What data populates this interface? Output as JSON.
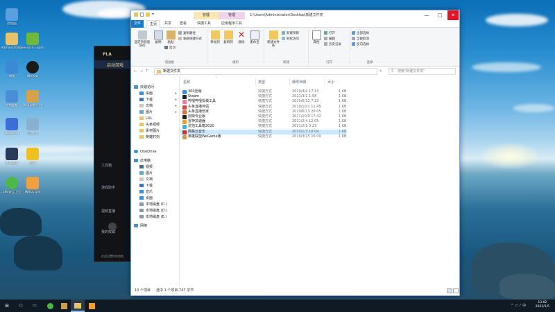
{
  "desktop": {
    "icons": [
      {
        "label": "此电脑",
        "color": "#5aa0e0"
      },
      {
        "label": "Administrator",
        "color": "#e8c36a"
      },
      {
        "label": "GeForce Experience",
        "color": "#6eb83a"
      },
      {
        "label": "网络",
        "color": "#3b8ad8"
      },
      {
        "label": "腾讯QQ",
        "color": "#1a1a1a"
      },
      {
        "label": "控制面板",
        "color": "#4a8fd6"
      },
      {
        "label": "腾讯游戏平台",
        "color": "#d4a24a"
      },
      {
        "label": "WeGame",
        "color": "#3c6fd6"
      },
      {
        "label": "回收站",
        "color": "#8ab0d0"
      },
      {
        "label": "英雄联盟",
        "color": "#2a3a5a"
      },
      {
        "label": "迅雷",
        "color": "#f0c020"
      },
      {
        "label": "360安全卫士",
        "color": "#4cb848"
      },
      {
        "label": "网易云音乐",
        "color": "#f0a040"
      }
    ]
  },
  "client": {
    "title": "PLA",
    "tag": "启动游戏",
    "side_items": [
      "工具箱",
      "游戏助手",
      "视频直播",
      "我的收藏"
    ],
    "banner": "在此设置你的游戏"
  },
  "window": {
    "ctx_tab_1": "管理",
    "ctx_tab_2": "管理",
    "path_title": "C:\\Users\\Administrator\\Desktop\\新建文件夹",
    "minimize": "—",
    "maximize": "□",
    "close": "✕",
    "ribbon_tabs": {
      "file": "文件",
      "home": "主页",
      "share": "共享",
      "view": "查看",
      "shortcut_tools": "快捷工具",
      "app_tools": "应用程序工具"
    },
    "ribbon": {
      "pin_quick": "固定到快速访问",
      "copy": "复制",
      "paste": "粘贴",
      "copy_path": "复制路径",
      "paste_shortcut": "粘贴快捷方式",
      "cut": "剪切",
      "clipboard": "剪贴板",
      "move_to": "移动到",
      "copy_to": "复制到",
      "delete": "删除",
      "rename": "重命名",
      "organize": "组织",
      "new_folder": "新建文件夹",
      "new_item": "新建项目",
      "easy_access": "轻松访问",
      "new": "新建",
      "properties": "属性",
      "open": "打开",
      "edit": "编辑",
      "history": "历史记录",
      "open_group": "打开",
      "select_all": "全部选择",
      "select_none": "全部取消",
      "invert_selection": "反向选择",
      "select": "选择"
    },
    "address": "新建文件夹",
    "search_placeholder": "搜索\"新建文件夹\"",
    "nav": {
      "quick_access": "快速访问",
      "desktop": "桌面",
      "downloads": "下载",
      "documents": "文档",
      "pictures": "图片",
      "lol": "LOL",
      "toutiao_video": "头条视频",
      "material_pics": "素材图片",
      "hero_record": "英雄时刻",
      "onedrive": "OneDrive",
      "this_pc": "此电脑",
      "videos": "视频",
      "pictures2": "图片",
      "documents2": "文档",
      "downloads2": "下载",
      "music": "音乐",
      "desktop2": "桌面",
      "disk_c": "本地磁盘 (C:)",
      "disk_d": "本地磁盘 (D:)",
      "disk_e": "本地磁盘 (E:)",
      "network": "网络"
    },
    "columns": {
      "name": "名称",
      "type": "类型",
      "date": "修改日期",
      "size": "大小"
    },
    "files": [
      {
        "name": "360压缩",
        "type": "快捷方式",
        "date": "2020/4/4 17:13",
        "size": "1 KB",
        "color": "#3c8ee0"
      },
      {
        "name": "Steam",
        "type": "快捷方式",
        "date": "2021/3/1 1:58",
        "size": "1 KB",
        "color": "#1b2838"
      },
      {
        "name": "哔哩哔哩投稿工具",
        "type": "快捷方式",
        "date": "2020/6/11 7:23",
        "size": "1 KB",
        "color": "#f07aa0"
      },
      {
        "name": "头条直播伴侣",
        "type": "快捷方式",
        "date": "2019/10/1 11:45",
        "size": "1 KB",
        "color": "#e04040"
      },
      {
        "name": "头条直播管家",
        "type": "快捷方式",
        "date": "2019/6/13 20:05",
        "size": "1 KB",
        "color": "#e86a30"
      },
      {
        "name": "剪映专业版",
        "type": "快捷方式",
        "date": "2021/10/9 17:42",
        "size": "1 KB",
        "color": "#222222"
      },
      {
        "name": "雷神加速器",
        "type": "快捷方式",
        "date": "2021/2/4 12:05",
        "size": "1 KB",
        "color": "#f0a020"
      },
      {
        "name": "爱拍工具箱2020",
        "type": "快捷方式",
        "date": "2021/2/1 0:23",
        "size": "1 KB",
        "color": "#3cb0e0"
      },
      {
        "name": "网易云音乐",
        "type": "快捷方式",
        "date": "2020/1/3 18:04",
        "size": "1 KB",
        "color": "#d03030"
      },
      {
        "name": "英雄联盟WeGame版",
        "type": "快捷方式",
        "date": "2019/3/15 16:09",
        "size": "1 KB",
        "color": "#c8a050"
      }
    ],
    "status": {
      "count": "10 个项目",
      "selected": "选中 1 个项目  747 字节"
    }
  },
  "taskbar": {
    "start": "⊞",
    "search": "○",
    "taskview": "▭",
    "tray": "^ ▭ ♪ 中",
    "time": "13:02",
    "date": "2022/1/5"
  }
}
